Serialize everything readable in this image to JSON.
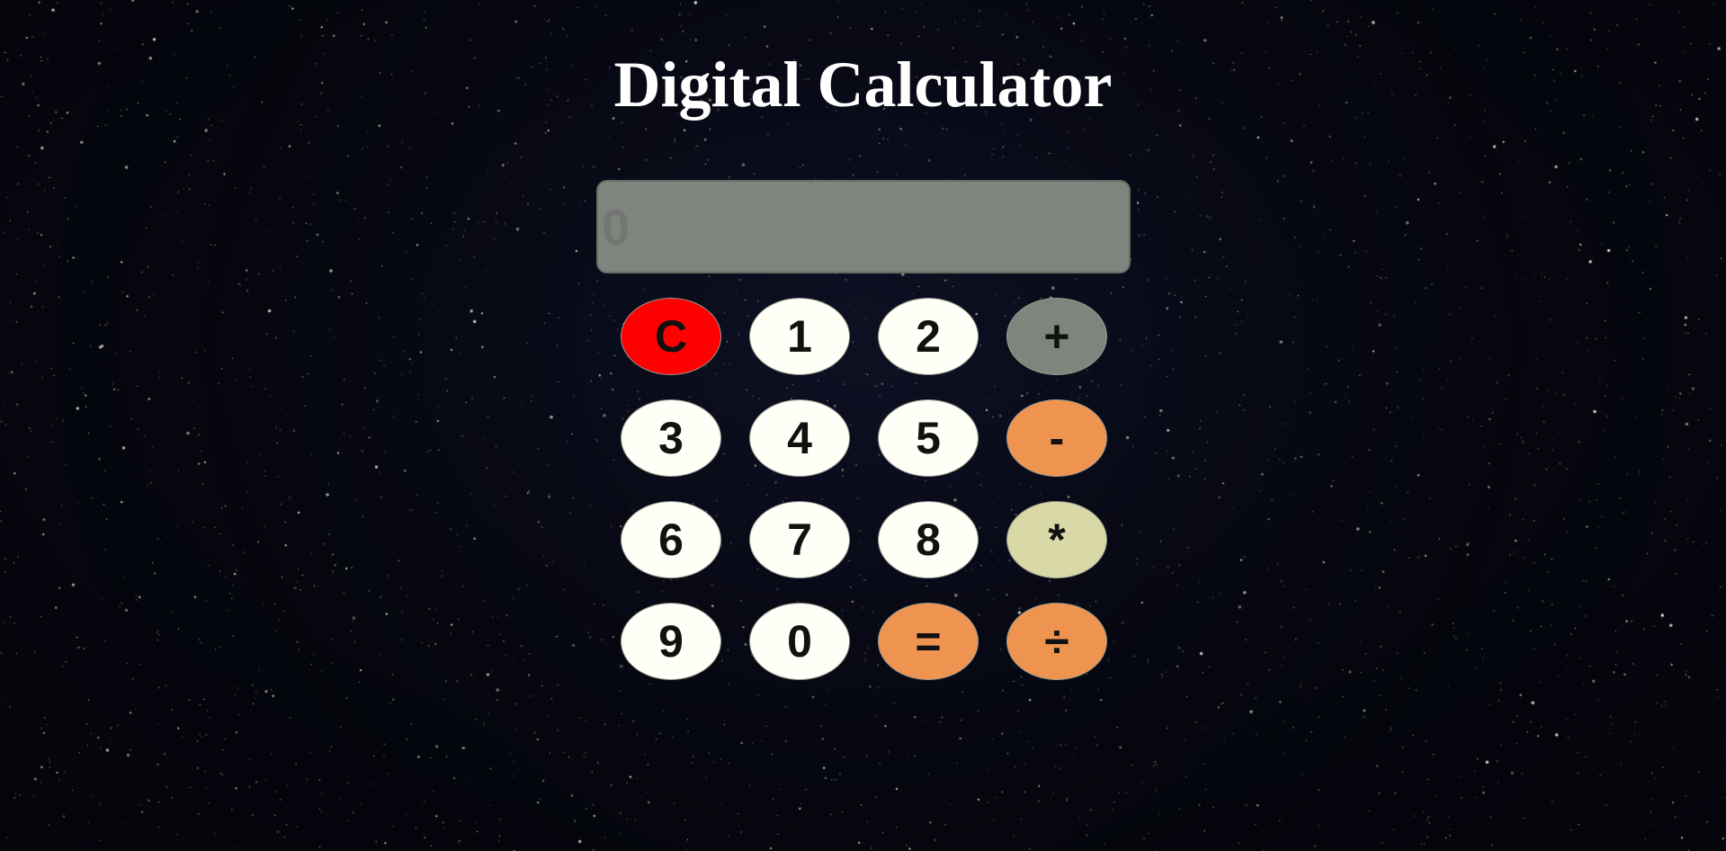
{
  "page": {
    "title": "Digital Calculator"
  },
  "display": {
    "placeholder": "0",
    "value": ""
  },
  "keys": [
    {
      "label": "C",
      "name": "clear-button",
      "color": "#fe0000"
    },
    {
      "label": "1",
      "name": "digit-1-button",
      "color": "#fffff7"
    },
    {
      "label": "2",
      "name": "digit-2-button",
      "color": "#fffff7"
    },
    {
      "label": "+",
      "name": "add-button",
      "color": "#7e857c"
    },
    {
      "label": "3",
      "name": "digit-3-button",
      "color": "#fffff7"
    },
    {
      "label": "4",
      "name": "digit-4-button",
      "color": "#fffff7"
    },
    {
      "label": "5",
      "name": "digit-5-button",
      "color": "#fffff7"
    },
    {
      "label": "-",
      "name": "subtract-button",
      "color": "#ee9450"
    },
    {
      "label": "6",
      "name": "digit-6-button",
      "color": "#fffff7"
    },
    {
      "label": "7",
      "name": "digit-7-button",
      "color": "#fffff7"
    },
    {
      "label": "8",
      "name": "digit-8-button",
      "color": "#fffff7"
    },
    {
      "label": "*",
      "name": "multiply-button",
      "color": "#d8d9a6"
    },
    {
      "label": "9",
      "name": "digit-9-button",
      "color": "#fffff7"
    },
    {
      "label": "0",
      "name": "digit-0-button",
      "color": "#fffff7"
    },
    {
      "label": "=",
      "name": "equals-button",
      "color": "#ee9450"
    },
    {
      "label": "÷",
      "name": "divide-button",
      "color": "#ee9450"
    }
  ],
  "colors": {
    "background": "#06070f",
    "star": "#f2f0dc",
    "title": "#ffffff",
    "display_bg": "#7e857c",
    "display_text": "#5a5f5a"
  }
}
